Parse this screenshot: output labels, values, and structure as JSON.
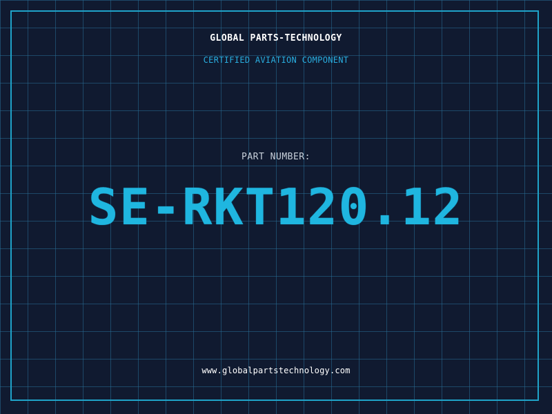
{
  "header": {
    "company": "GLOBAL PARTS-TECHNOLOGY",
    "subtitle": "CERTIFIED AVIATION COMPONENT"
  },
  "part": {
    "label": "PART NUMBER:",
    "number": "SE-RKT120.12"
  },
  "footer": {
    "url": "www.globalpartstechnology.com"
  },
  "colors": {
    "background": "#101a30",
    "grid": "#286e96",
    "accent": "#1fb6e0",
    "frame": "#1fa3c9",
    "text": "#ffffff"
  }
}
